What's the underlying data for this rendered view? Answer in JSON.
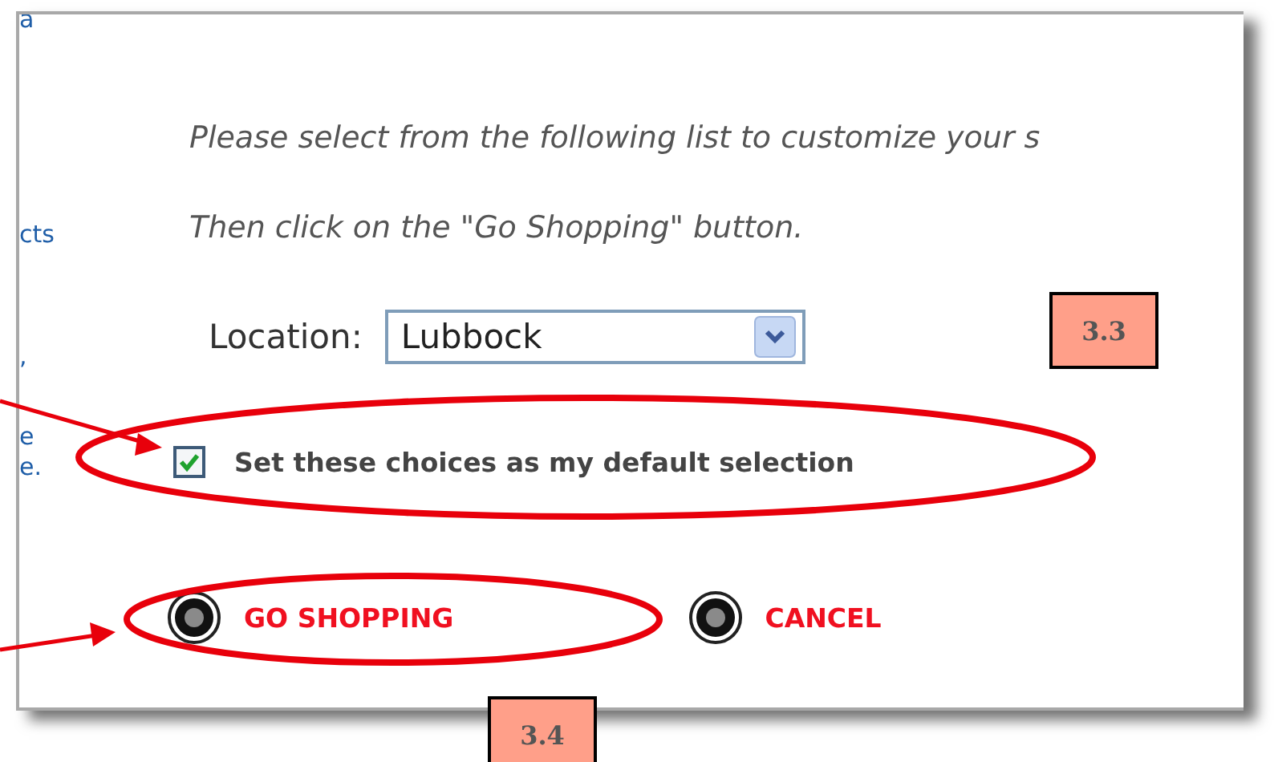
{
  "sidebar_fragments": [
    "a",
    "cts",
    ",",
    "e",
    "e."
  ],
  "instructions": [
    "Please select from the following list to customize your s",
    "Then click on the \"Go Shopping\" button."
  ],
  "location": {
    "label": "Location:",
    "value": "Lubbock"
  },
  "default_checkbox": {
    "label": "Set these choices as my default selection",
    "checked": true
  },
  "buttons": [
    "GO SHOPPING",
    "CANCEL"
  ],
  "annotation_labels": [
    "3.3",
    "3.4"
  ]
}
